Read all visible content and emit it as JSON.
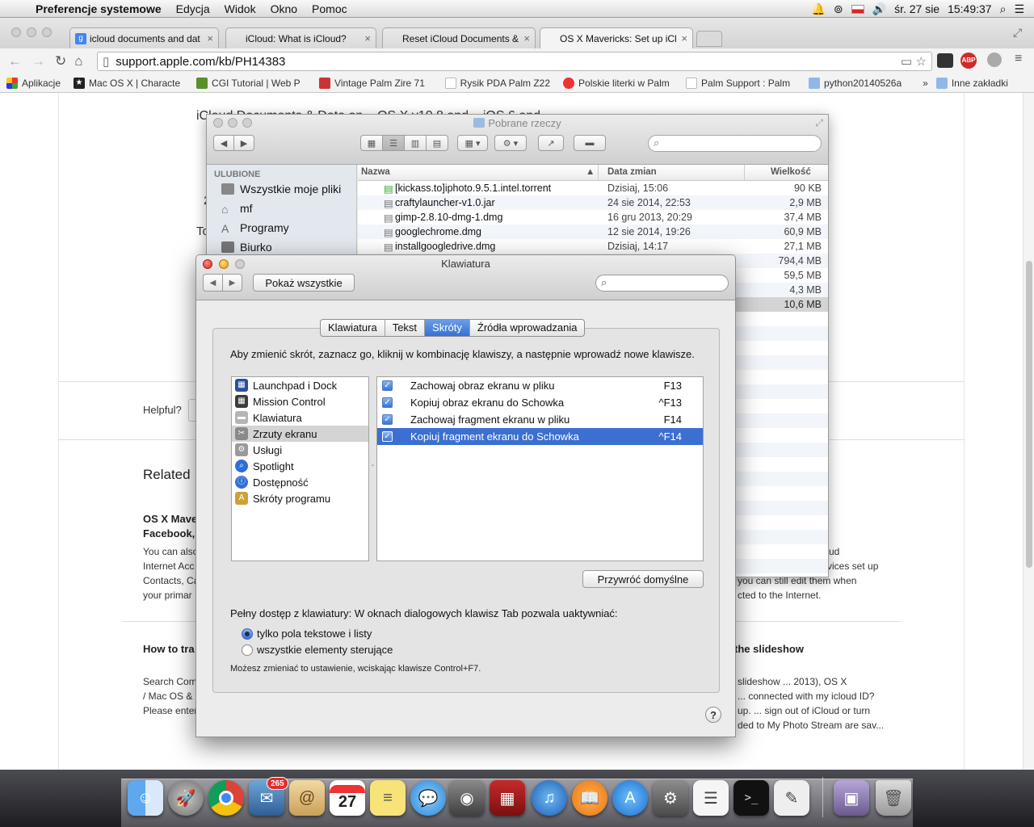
{
  "menubar": {
    "app_name": "Preferencje systemowe",
    "items": [
      "Edycja",
      "Widok",
      "Okno",
      "Pomoc"
    ],
    "clock_date": "śr. 27 sie",
    "clock_time": "15:49:37"
  },
  "browser": {
    "tabs": [
      {
        "title": "icloud documents and dat",
        "icon": "google-icon"
      },
      {
        "title": "iCloud: What is iCloud?",
        "icon": "apple-icon"
      },
      {
        "title": "Reset iCloud Documents &",
        "icon": "apple-icon"
      },
      {
        "title": "OS X Mavericks: Set up iClo",
        "icon": "apple-icon"
      }
    ],
    "url": "support.apple.com/kb/PH14383",
    "bookmarks": [
      "Aplikacje",
      "Mac OS X | Characte",
      "CGI Tutorial | Web P",
      "Vintage Palm Zire 71",
      "Rysik PDA Palm Z22",
      "Polskie literki w Palm",
      "Palm Support : Palm",
      "python20140526a"
    ],
    "bookmarks_more": "»",
    "bookmarks_other": "Inne zakładki"
  },
  "webpage": {
    "heading_partial": "iCloud Documents & Data on ...OS X v10.8 and ...iOS 6 and ...",
    "frag_2": "2",
    "frag_to": "To",
    "helpful": "Helpful?",
    "related": "Related",
    "left_link_1": "OS X Mave",
    "left_link_2": "Facebook,",
    "left_text": [
      "You can also",
      "Internet Acc",
      "Contacts, Ca",
      "your primar"
    ],
    "right_text": [
      "ud",
      "vices set up",
      "you can still edit them when",
      "cted to the Internet."
    ],
    "how_to": "How to tra",
    "the_slideshow": "the slideshow",
    "bottom_left": [
      "Search Com",
      "/ Mac OS &",
      "Please enter"
    ],
    "bottom_right": [
      "slideshow ... 2013), OS X",
      "... connected with my icloud ID?",
      "up. ... sign out of iCloud or turn",
      "ded to My Photo Stream are sav..."
    ]
  },
  "finder": {
    "title": "Pobrane rzeczy",
    "sidebar_header": "ULUBIONE",
    "sidebar_items": [
      {
        "label": "Wszystkie moje pliki",
        "icon": "all-files-icon"
      },
      {
        "label": "mf",
        "icon": "home-icon"
      },
      {
        "label": "Programy",
        "icon": "applications-icon"
      },
      {
        "label": "Biurko",
        "icon": "desktop-icon"
      }
    ],
    "columns": {
      "name": "Nazwa",
      "date": "Data zmian",
      "size": "Wielkość"
    },
    "files": [
      {
        "name": "[kickass.to]iphoto.9.5.1.intel.torrent",
        "date": "Dzisiaj, 15:06",
        "size": "90 KB"
      },
      {
        "name": "craftylauncher-v1.0.jar",
        "date": "24 sie 2014, 22:53",
        "size": "2,9 MB"
      },
      {
        "name": "gimp-2.8.10-dmg-1.dmg",
        "date": "16 gru 2013, 20:29",
        "size": "37,4 MB"
      },
      {
        "name": "googlechrome.dmg",
        "date": "12 sie 2014, 19:26",
        "size": "60,9 MB"
      },
      {
        "name": "installgoogledrive.dmg",
        "date": "Dzisiaj, 14:17",
        "size": "27,1 MB"
      }
    ],
    "extra_sizes": [
      "794,4 MB",
      "59,5 MB",
      "4,3 MB",
      "10,6 MB"
    ]
  },
  "prefs": {
    "title": "Klawiatura",
    "show_all": "Pokaż wszystkie",
    "search_placeholder": "",
    "tabs": [
      "Klawiatura",
      "Tekst",
      "Skróty",
      "Źródła wprowadzania"
    ],
    "selected_tab": "Skróty",
    "instructions": "Aby zmienić skrót, zaznacz go, kliknij w kombinację klawiszy, a następnie wprowadź nowe klawisze.",
    "categories": [
      {
        "label": "Launchpad i Dock",
        "icon": "launchpad-icon",
        "color": "#2b4f9a"
      },
      {
        "label": "Mission Control",
        "icon": "mission-control-icon",
        "color": "#3c3c3c"
      },
      {
        "label": "Klawiatura",
        "icon": "keyboard-icon",
        "color": "#9a9a9a"
      },
      {
        "label": "Zrzuty ekranu",
        "icon": "screenshot-icon",
        "color": "#7d7d7d"
      },
      {
        "label": "Usługi",
        "icon": "gear-icon",
        "color": "#8a8a8a"
      },
      {
        "label": "Spotlight",
        "icon": "spotlight-icon",
        "color": "#2f6fd8"
      },
      {
        "label": "Dostępność",
        "icon": "accessibility-icon",
        "color": "#2f6fd8"
      },
      {
        "label": "Skróty programu",
        "icon": "app-shortcuts-icon",
        "color": "#c9a23a"
      }
    ],
    "selected_category": "Zrzuty ekranu",
    "shortcuts": [
      {
        "label": "Zachowaj obraz ekranu w pliku",
        "key": "F13",
        "checked": true
      },
      {
        "label": "Kopiuj obraz ekranu do Schowka",
        "key": "^F13",
        "checked": true
      },
      {
        "label": "Zachowaj fragment ekranu w pliku",
        "key": "F14",
        "checked": true
      },
      {
        "label": "Kopiuj fragment ekranu do Schowka",
        "key": "^F14",
        "checked": true
      }
    ],
    "restore_defaults": "Przywróć domyślne",
    "full_access": "Pełny dostęp z klawiatury: W oknach dialogowych klawisz Tab pozwala uaktywniać:",
    "radio_1": "tylko pola tekstowe i listy",
    "radio_2": "wszystkie elementy sterujące",
    "hint": "Możesz zmieniać to ustawienie, wciskając klawisze Control+F7.",
    "help": "?"
  },
  "dock": {
    "mail_badge": "265",
    "calendar_day": "27"
  },
  "colors": {
    "selection": "#3b6fd2",
    "accent": "#2f6fd8"
  }
}
